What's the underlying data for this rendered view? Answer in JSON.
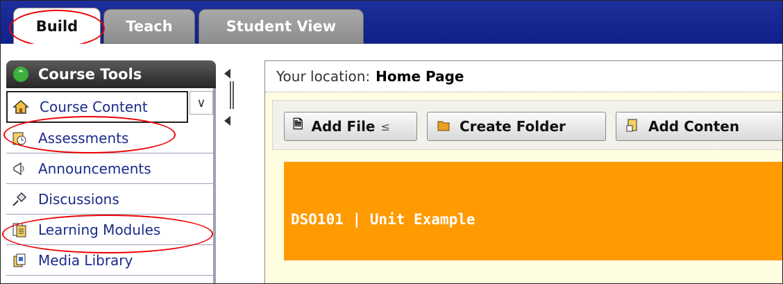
{
  "tabs": {
    "build": "Build",
    "teach": "Teach",
    "student_view": "Student View"
  },
  "sidebar": {
    "header": "Course Tools",
    "header_icon": "collapse-up-icon",
    "items": [
      {
        "label": "Course Content",
        "icon": "home-icon"
      },
      {
        "label": "Assessments",
        "icon": "assessment-icon"
      },
      {
        "label": "Announcements",
        "icon": "megaphone-icon"
      },
      {
        "label": "Discussions",
        "icon": "pin-icon"
      },
      {
        "label": "Learning Modules",
        "icon": "modules-icon"
      },
      {
        "label": "Media Library",
        "icon": "media-icon"
      }
    ]
  },
  "location": {
    "label": "Your location:",
    "value": "Home Page"
  },
  "toolbar": {
    "add_file": "Add File",
    "create_folder": "Create Folder",
    "add_content": "Add Conten"
  },
  "banner": {
    "title": "DSO101 | Unit Example"
  },
  "colors": {
    "top_bar": "#10208a",
    "banner": "#ff9a00",
    "content_bg": "#fffde0",
    "highlight_ring": "#ee0000"
  }
}
